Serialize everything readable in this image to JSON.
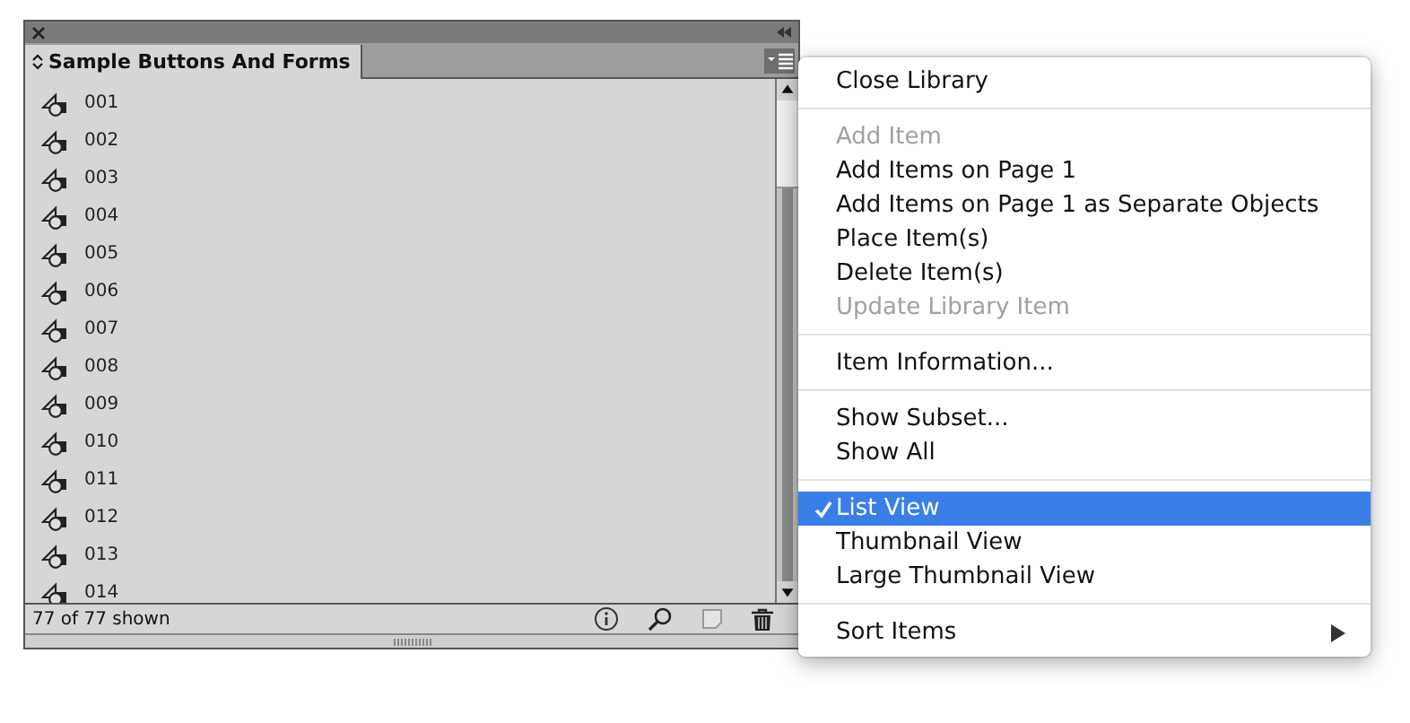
{
  "panel": {
    "tab": {
      "label": "Sample Buttons And Forms",
      "selected": true
    },
    "items": [
      "001",
      "002",
      "003",
      "004",
      "005",
      "006",
      "007",
      "008",
      "009",
      "010",
      "011",
      "012",
      "013",
      "014"
    ],
    "status": "77 of 77 shown"
  },
  "menu": {
    "groups": [
      [
        {
          "label": "Close Library",
          "disabled": false,
          "checked": false,
          "selected": false,
          "submenu": false
        }
      ],
      [
        {
          "label": "Add Item",
          "disabled": true,
          "checked": false,
          "selected": false,
          "submenu": false
        },
        {
          "label": "Add Items on Page 1",
          "disabled": false,
          "checked": false,
          "selected": false,
          "submenu": false
        },
        {
          "label": "Add Items on Page 1 as Separate Objects",
          "disabled": false,
          "checked": false,
          "selected": false,
          "submenu": false
        },
        {
          "label": "Place Item(s)",
          "disabled": false,
          "checked": false,
          "selected": false,
          "submenu": false
        },
        {
          "label": "Delete Item(s)",
          "disabled": false,
          "checked": false,
          "selected": false,
          "submenu": false
        },
        {
          "label": "Update Library Item",
          "disabled": true,
          "checked": false,
          "selected": false,
          "submenu": false
        }
      ],
      [
        {
          "label": "Item Information...",
          "disabled": false,
          "checked": false,
          "selected": false,
          "submenu": false
        }
      ],
      [
        {
          "label": "Show Subset...",
          "disabled": false,
          "checked": false,
          "selected": false,
          "submenu": false
        },
        {
          "label": "Show All",
          "disabled": false,
          "checked": false,
          "selected": false,
          "submenu": false
        }
      ],
      [
        {
          "label": "List View",
          "disabled": false,
          "checked": true,
          "selected": true,
          "submenu": false
        },
        {
          "label": "Thumbnail View",
          "disabled": false,
          "checked": false,
          "selected": false,
          "submenu": false
        },
        {
          "label": "Large Thumbnail View",
          "disabled": false,
          "checked": false,
          "selected": false,
          "submenu": false
        }
      ],
      [
        {
          "label": "Sort Items",
          "disabled": false,
          "checked": false,
          "selected": false,
          "submenu": true
        }
      ]
    ]
  }
}
